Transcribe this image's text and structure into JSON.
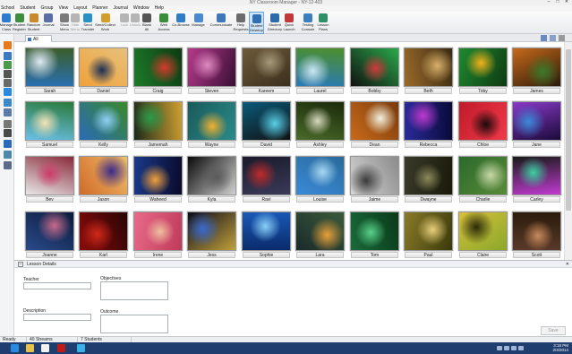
{
  "window": {
    "title": "NY Classroom Manager - NY-12-403",
    "controls": [
      "–",
      "□",
      "✕"
    ]
  },
  "menu": [
    "School",
    "Student",
    "Group",
    "View",
    "Layout",
    "Planner",
    "Journal",
    "Window",
    "Help"
  ],
  "ribbon": [
    {
      "label": "Manage\nClass",
      "icon": "manage-class-icon",
      "color": "#2e7bcf",
      "disabled": false
    },
    {
      "label": "Student\nRegister",
      "icon": "student-register-icon",
      "color": "#3d8f3d",
      "disabled": false
    },
    {
      "label": "Random\nStudent",
      "icon": "random-student-icon",
      "color": "#c9892c",
      "disabled": false
    },
    {
      "label": "Journal",
      "icon": "journal-icon",
      "color": "#5a6fa8",
      "disabled": false
    },
    {
      "label": "Show\nMenu",
      "icon": "show-menu-icon",
      "color": "#7a7a7a",
      "disabled": false
    },
    {
      "label": "Hide\nMenu",
      "icon": "hide-menu-icon",
      "color": "#b5b5b5",
      "disabled": true
    },
    {
      "label": "Send\nTransfer",
      "icon": "send-transfer-icon",
      "color": "#2a8fc4",
      "disabled": false
    },
    {
      "label": "Send/Collect\nWork",
      "icon": "send-collect-icon",
      "color": "#d0a02a",
      "disabled": false
    },
    {
      "label": "Lock",
      "icon": "lock-icon",
      "color": "#b5b5b5",
      "disabled": true
    },
    {
      "label": "Unlock",
      "icon": "unlock-icon",
      "color": "#b5b5b5",
      "disabled": true
    },
    {
      "label": "Blank\nAll",
      "icon": "blank-screen-icon",
      "color": "#555",
      "disabled": false
    },
    {
      "label": "Web\nAccess",
      "icon": "web-access-icon",
      "color": "#3a8e3a",
      "disabled": false
    },
    {
      "label": "Co-Browse",
      "icon": "co-browse-icon",
      "color": "#2f7dc8",
      "disabled": false
    },
    {
      "label": "Manage",
      "icon": "manage-icon",
      "color": "#4a8ad0",
      "disabled": false
    },
    {
      "label": "Communicate",
      "icon": "communicate-icon",
      "color": "#3f77b8",
      "disabled": false
    },
    {
      "label": "Help\nRequests",
      "icon": "help-requests-icon",
      "color": "#6c6c6c",
      "disabled": false
    },
    {
      "label": "Student\nDesktop",
      "icon": "student-desktop-icon",
      "color": "#2f6fb2",
      "disabled": false,
      "active": true
    },
    {
      "label": "Student\nDirectory",
      "icon": "student-directory-icon",
      "color": "#2c6aa8",
      "disabled": false
    },
    {
      "label": "Quick\nLaunch",
      "icon": "quick-launch-icon",
      "color": "#c03a3a",
      "disabled": false
    },
    {
      "label": "Testing\nConsole",
      "icon": "testing-console-icon",
      "color": "#3c7fc0",
      "disabled": false
    },
    {
      "label": "Lesson\nPlans",
      "icon": "lesson-plans-icon",
      "color": "#2f8f6a",
      "disabled": false
    }
  ],
  "tab": {
    "label": "All"
  },
  "students": [
    {
      "name": "Sarah",
      "colors": [
        "#2a6fb0",
        "#dfe9f3",
        "#3b5d2a"
      ]
    },
    {
      "name": "Daniel",
      "colors": [
        "#f0a23a",
        "#1a2f55",
        "#e7c07a"
      ]
    },
    {
      "name": "Craig",
      "colors": [
        "#1d7a2a",
        "#d43a2a",
        "#0d3a12"
      ]
    },
    {
      "name": "Steven",
      "colors": [
        "#b43a8a",
        "#e08ac2",
        "#3a0f35"
      ]
    },
    {
      "name": "Kareem",
      "colors": [
        "#6d5a3a",
        "#a69a7a",
        "#3b2f1d"
      ]
    },
    {
      "name": "Laurel",
      "colors": [
        "#2a7ab8",
        "#cde8f5",
        "#4d8f2a"
      ]
    },
    {
      "name": "Bobby",
      "colors": [
        "#111111",
        "#d03a3a",
        "#2aa84a"
      ]
    },
    {
      "name": "Beth",
      "colors": [
        "#9a6a2a",
        "#d8b06a",
        "#3a2a12"
      ]
    },
    {
      "name": "Toby",
      "colors": [
        "#1e8a2e",
        "#f2b21a",
        "#0f3a14"
      ]
    },
    {
      "name": "James",
      "colors": [
        "#c86a1a",
        "#3a7a2a",
        "#2a1a0a"
      ]
    },
    {
      "name": "Samuel",
      "colors": [
        "#6ac0e8",
        "#f4e3b5",
        "#2a7a3a"
      ]
    },
    {
      "name": "Kelly",
      "colors": [
        "#2a6ab8",
        "#8fd0f5",
        "#3a8a2a"
      ]
    },
    {
      "name": "Jamemah",
      "colors": [
        "#1a2a1a",
        "#2a9a4a",
        "#d0a030"
      ]
    },
    {
      "name": "Wayne",
      "colors": [
        "#1a5a5a",
        "#f0b030",
        "#2a8a8a"
      ]
    },
    {
      "name": "David",
      "colors": [
        "#0a5a7a",
        "#5ad0e8",
        "#111111"
      ]
    },
    {
      "name": "Ashley",
      "colors": [
        "#4a6a2a",
        "#d8d8c0",
        "#1a2a0a"
      ]
    },
    {
      "name": "Dean",
      "colors": [
        "#c86a1a",
        "#f2f2e0",
        "#7a3a0a"
      ]
    },
    {
      "name": "Rebecca",
      "colors": [
        "#2a2a9a",
        "#c03ad0",
        "#0a0a3a"
      ]
    },
    {
      "name": "Chloe",
      "colors": [
        "#c01a2a",
        "#1a0a0a",
        "#f03a4a"
      ]
    },
    {
      "name": "Jane",
      "colors": [
        "#8a3ac8",
        "#3a8ad8",
        "#1a0a3a"
      ]
    },
    {
      "name": "Bev",
      "colors": [
        "#e8e8e8",
        "#d03a6a",
        "#8a2a3a"
      ]
    },
    {
      "name": "Jason",
      "colors": [
        "#d06a2a",
        "#3a2a8a",
        "#f0c06a"
      ]
    },
    {
      "name": "Waheed",
      "colors": [
        "#1a3a8a",
        "#f0a03a",
        "#0a0a2a"
      ]
    },
    {
      "name": "Kyla",
      "colors": [
        "#0a0a0a",
        "#5a5a5a",
        "#d0d0d0"
      ]
    },
    {
      "name": "Ravi",
      "colors": [
        "#1a1a2a",
        "#c02a2a",
        "#3a3a5a"
      ]
    },
    {
      "name": "Louise",
      "colors": [
        "#3a8ad8",
        "#a8d8f0",
        "#2a6a9a"
      ]
    },
    {
      "name": "Jaime",
      "colors": [
        "#d8d8d8",
        "#3a3a3a",
        "#8a8a8a"
      ]
    },
    {
      "name": "Dwayne",
      "colors": [
        "#3a3a2a",
        "#8a8a5a",
        "#1a1a0a"
      ]
    },
    {
      "name": "Charlie",
      "colors": [
        "#2a6a2a",
        "#c8d8a8",
        "#5a8a3a"
      ]
    },
    {
      "name": "Carley",
      "colors": [
        "#1a1a1a",
        "#3ad0a0",
        "#c03ad0"
      ]
    },
    {
      "name": "Joanne",
      "colors": [
        "#2a4a8a",
        "#c86a8a",
        "#0a1a3a"
      ]
    },
    {
      "name": "Karl",
      "colors": [
        "#8a0a0a",
        "#d02a1a",
        "#2a0505"
      ]
    },
    {
      "name": "Irene",
      "colors": [
        "#e86a8a",
        "#f0c0a0",
        "#c03a5a"
      ]
    },
    {
      "name": "Jess",
      "colors": [
        "#0a0a1a",
        "#3a6ad0",
        "#c0a03a"
      ]
    },
    {
      "name": "Sophie",
      "colors": [
        "#1a5ab8",
        "#8ad0f8",
        "#0a2a6a"
      ]
    },
    {
      "name": "Lara",
      "colors": [
        "#1a2a2a",
        "#e8a03a",
        "#3a5a3a"
      ]
    },
    {
      "name": "Tom",
      "colors": [
        "#1a6a3a",
        "#5ad08a",
        "#0a3a1a"
      ]
    },
    {
      "name": "Paul",
      "colors": [
        "#8a7a2a",
        "#e8d07a",
        "#3a3a0a"
      ]
    },
    {
      "name": "Claire",
      "colors": [
        "#d8c03a",
        "#2a2a0a",
        "#8aa82a"
      ]
    },
    {
      "name": "Scott",
      "colors": [
        "#5a3a2a",
        "#c88a5a",
        "#2a1a0a"
      ]
    }
  ],
  "details": {
    "header": "Lesson Details",
    "teacher_label": "Teacher",
    "teacher_value": "",
    "description_label": "Description",
    "description_value": "",
    "objectives_label": "Objectives",
    "objectives_value": "",
    "outcome_label": "Outcome",
    "outcome_value": "",
    "save_label": "Save"
  },
  "status": [
    "Ready",
    "40 Streams",
    "7 Students"
  ],
  "taskbar": {
    "apps": [
      {
        "name": "ie-icon",
        "color": "#2a8ae0"
      },
      {
        "name": "folder-icon",
        "color": "#e8c04a"
      },
      {
        "name": "amazon-icon",
        "color": "#f2f2f2"
      },
      {
        "name": "mcafee-icon",
        "color": "#c01a1a"
      },
      {
        "name": "classroom-manager-icon",
        "color": "#3ab0e8"
      }
    ],
    "time": "3:18 PM",
    "date": "2/4/2014"
  }
}
